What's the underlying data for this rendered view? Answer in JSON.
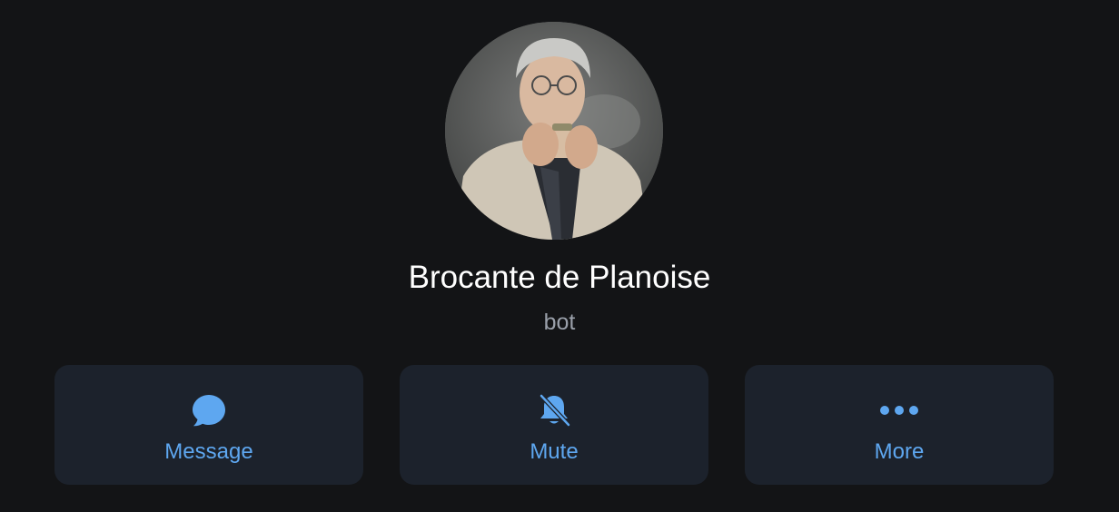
{
  "profile": {
    "name": "Brocante de Planoise",
    "status": "bot",
    "avatar_icon": "portrait-avatar"
  },
  "actions": [
    {
      "label": "Message",
      "icon": "chat-bubble-icon"
    },
    {
      "label": "Mute",
      "icon": "bell-slash-icon"
    },
    {
      "label": "More",
      "icon": "more-dots-icon"
    }
  ],
  "colors": {
    "background": "#131416",
    "button_bg": "#1c222c",
    "accent": "#5ea7f0",
    "name_text": "#ffffff",
    "status_text": "#9aa0aa"
  }
}
